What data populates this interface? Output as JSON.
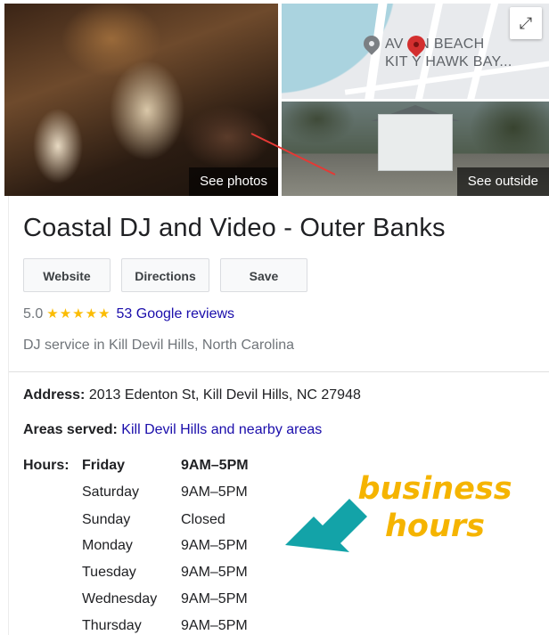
{
  "photos": {
    "see_photos_label": "See photos",
    "see_outside_label": "See outside",
    "map_text_line1": "AV  ON BEACH",
    "map_text_line2": "KIT  Y HAWK BAY...",
    "expand_icon": "expand-icon"
  },
  "business": {
    "name": "Coastal DJ and Video - Outer Banks",
    "buttons": {
      "website": "Website",
      "directions": "Directions",
      "save": "Save"
    },
    "rating": "5.0",
    "stars": "★★★★★",
    "reviews_link": "53 Google reviews",
    "category": "DJ service in Kill Devil Hills, North Carolina",
    "address_label": "Address:",
    "address_value": "2013 Edenton St, Kill Devil Hills, NC 27948",
    "areas_label": "Areas served:",
    "areas_value": "Kill Devil Hills and nearby areas",
    "hours_label": "Hours:",
    "hours": [
      {
        "day": "Friday",
        "time": "9AM–5PM"
      },
      {
        "day": "Saturday",
        "time": "9AM–5PM"
      },
      {
        "day": "Sunday",
        "time": "Closed"
      },
      {
        "day": "Monday",
        "time": "9AM–5PM"
      },
      {
        "day": "Tuesday",
        "time": "9AM–5PM"
      },
      {
        "day": "Wednesday",
        "time": "9AM–5PM"
      },
      {
        "day": "Thursday",
        "time": "9AM–5PM"
      }
    ]
  },
  "annotation": {
    "line1": "business",
    "line2": "hours",
    "color": "#f5b400",
    "arrow_color": "#13a3a8",
    "pointer_color": "#e53935"
  }
}
